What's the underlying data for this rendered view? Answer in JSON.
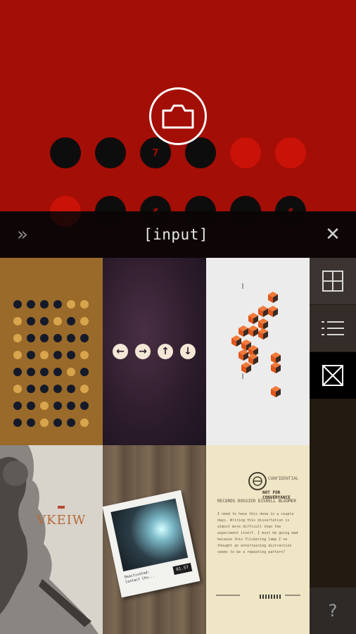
{
  "header": {
    "forward_label": "»",
    "title": "[input]",
    "close_label": "✕"
  },
  "camera": {
    "icon": "camera-icon"
  },
  "top_dots": {
    "row1": [
      {
        "color": "black",
        "glyph": ""
      },
      {
        "color": "black",
        "glyph": ""
      },
      {
        "color": "black",
        "glyph": "7"
      },
      {
        "color": "black",
        "glyph": ""
      },
      {
        "color": "red",
        "glyph": ""
      },
      {
        "color": "red",
        "glyph": ""
      }
    ],
    "row2": [
      {
        "color": "red",
        "glyph": ""
      },
      {
        "color": "black",
        "glyph": ""
      },
      {
        "color": "black",
        "glyph": "ꝭ"
      },
      {
        "color": "black",
        "glyph": ""
      },
      {
        "color": "black",
        "glyph": ""
      },
      {
        "color": "black",
        "glyph": "ꝭ"
      }
    ]
  },
  "tiles": {
    "arrows": [
      "←",
      "→",
      "↑",
      "↓"
    ],
    "vkeiw": {
      "title": "VKEIW"
    },
    "polaroid": {
      "caption": "Deactivated: Contact Chu...",
      "stamp": "01.57"
    },
    "document": {
      "header_left": "CONFIDENTIAL",
      "stamp": "NOT FOR CONVERYANCE",
      "heading": "RECORDS DOSSIER DISRELL BLOOMER",
      "body": "I need to have this done in a couple days. Writing this dissertation is almost more difficult than the experiment itself. I must be going mad because this flickering lamp I've thought an entertaining distraction seems to be a repeating pattern?"
    }
  },
  "sidebar": {
    "grid_icon": "grid-view-icon",
    "list_icon": "list-view-icon",
    "active_icon": "box-x-icon",
    "help_label": "?"
  },
  "colors": {
    "top_red": "#a30e06",
    "bright_red": "#c91208",
    "tile_gold": "#9a6a2a",
    "cube_orange": "#e0561b"
  }
}
